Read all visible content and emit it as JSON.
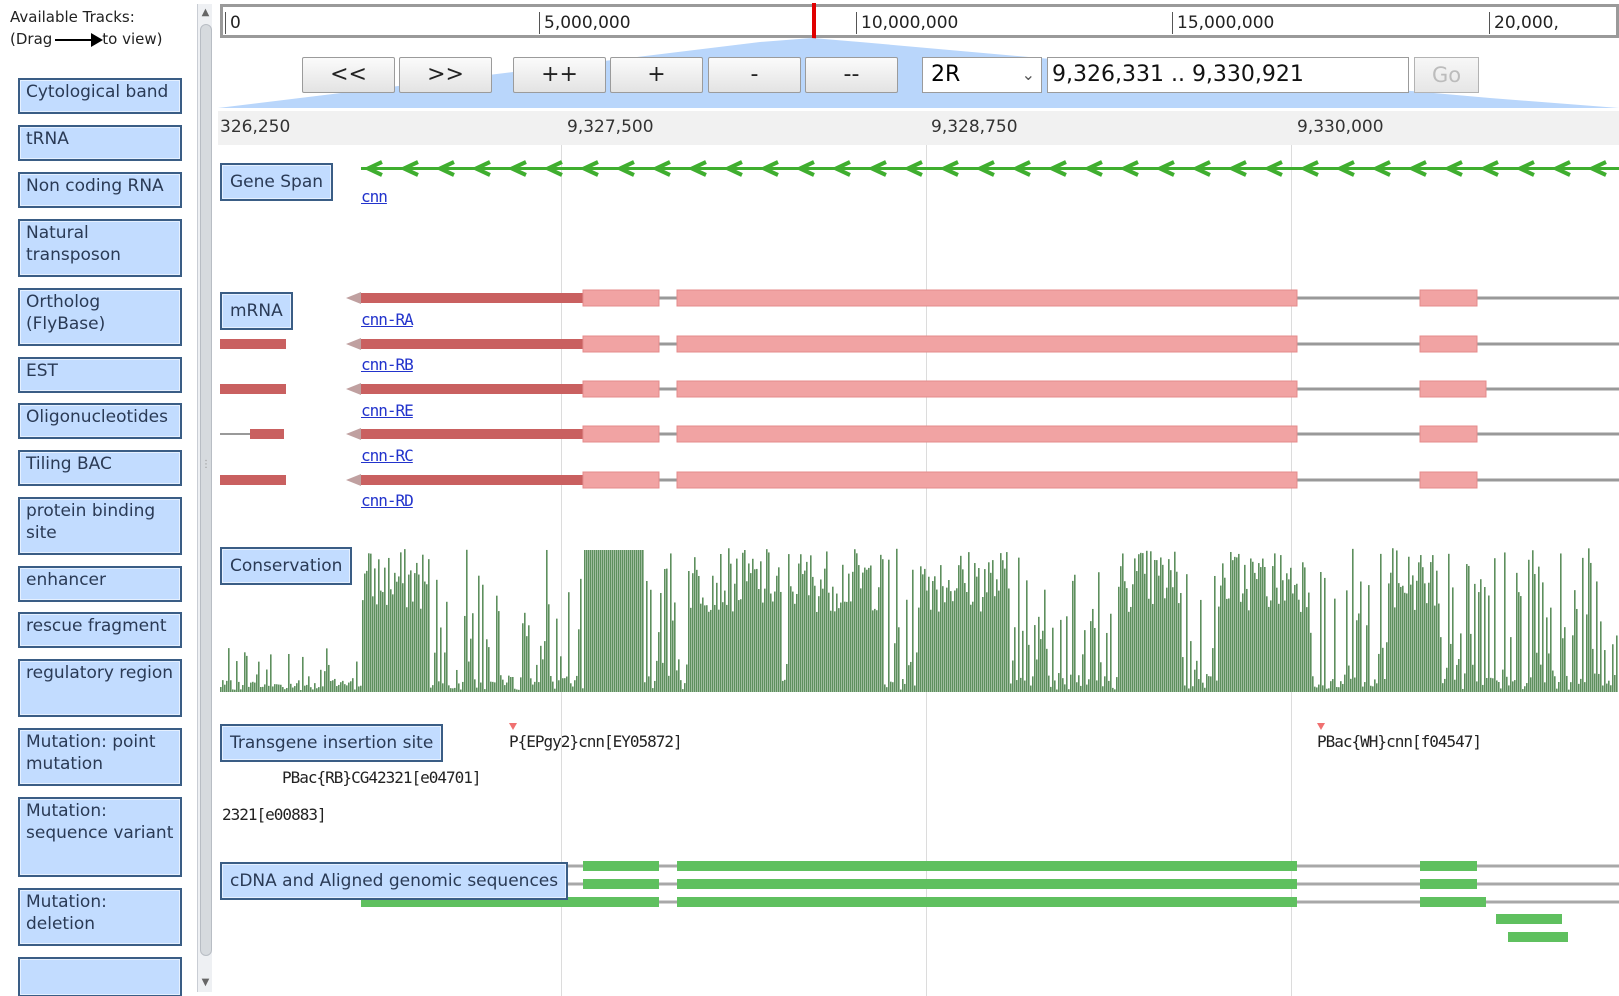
{
  "left_panel": {
    "title_line1": "Available Tracks:",
    "title_drag": "(Drag",
    "title_to_view": "to view)",
    "tracks": [
      "Cytological band",
      "tRNA",
      "Non coding RNA",
      "Natural transposon",
      "Ortholog (FlyBase)",
      "EST",
      "Oligonucleotides",
      "Tiling BAC",
      "protein binding site",
      "enhancer",
      "rescue fragment",
      "regulatory region",
      "Mutation: point mutation",
      "Mutation: sequence variant",
      "Mutation: deletion"
    ]
  },
  "overview": {
    "labels": [
      "0",
      "5,000,000",
      "10,000,000",
      "15,000,000",
      "20,000,"
    ]
  },
  "navigation": {
    "buttons": [
      "<<",
      ">>",
      "++",
      "+",
      "-",
      "--"
    ],
    "chromosome": "2R",
    "location": "9,326,331 .. 9,330,921",
    "go_label": "Go"
  },
  "ruler": {
    "labels": [
      "326,250",
      "9,327,500",
      "9,328,750",
      "9,330,000"
    ]
  },
  "tracks": {
    "gene_span": {
      "label": "Gene Span",
      "feature": "cnn"
    },
    "mrna": {
      "label": "mRNA",
      "transcripts": [
        "cnn-RA",
        "cnn-RB",
        "cnn-RE",
        "cnn-RC",
        "cnn-RD"
      ]
    },
    "conservation": {
      "label": "Conservation"
    },
    "transgene": {
      "label": "Transgene insertion site",
      "insertions": [
        "P{EPgy2}cnn[EY05872]",
        "PBac{WH}cnn[f04547]",
        "PBac{RB}CG42321[e04701]",
        "2321[e00883]"
      ],
      "marker_color": "#f07070"
    },
    "cdna": {
      "label": "cDNA and Aligned genomic sequences"
    }
  },
  "colors": {
    "track_button_bg": "#c2dcff",
    "track_button_border": "#3a5d85",
    "gene_green": "#3fae2f",
    "mrna_utr": "#c96060",
    "mrna_cds": "#f1a3a3",
    "intron": "#999999",
    "conservation": "#5d8f5d",
    "cdna": "#5fc05f",
    "overview_marker": "#e00000"
  }
}
